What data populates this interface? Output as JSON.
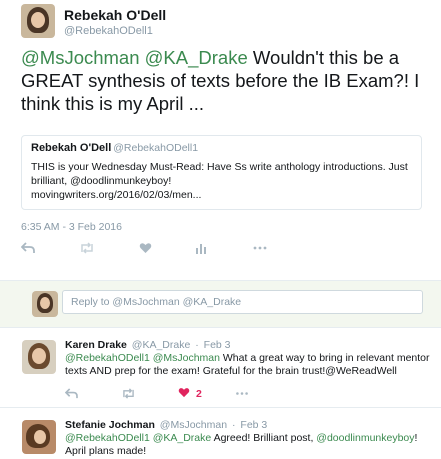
{
  "tweet": {
    "author_name": "Rebekah O'Dell",
    "author_handle": "@RebekahODell1",
    "text_mention1": "@MsJochman",
    "text_mention2": "@KA_Drake",
    "text_body": " Wouldn't this be a GREAT synthesis of texts before the IB Exam?! I think this is my April ...",
    "timestamp": "6:35 AM - 3 Feb 2016",
    "quote": {
      "name": "Rebekah O'Dell",
      "handle": "@RebekahODell1",
      "line1": "THIS is your Wednesday Must-Read: Have Ss write anthology introductions. Just",
      "line2": "brilliant, @doodlinmunkeyboy!",
      "line3": "movingwriters.org/2016/02/03/men..."
    },
    "actions": {
      "reply_icon": "reply-icon",
      "retweet_icon": "retweet-icon",
      "like_icon": "heart-icon",
      "stats_icon": "analytics-icon",
      "more_icon": "more-icon"
    }
  },
  "reply_box": {
    "placeholder": "Reply to @MsJochman @KA_Drake"
  },
  "replies": [
    {
      "name": "Karen Drake",
      "handle": "@KA_Drake",
      "date": "Feb 3",
      "mention1": "@RebekahODell1",
      "mention2": "@MsJochman",
      "text": " What a great way to bring in relevant mentor texts AND prep for the exam! Grateful for the brain trust!@WeReadWell",
      "like_count": "2"
    },
    {
      "name": "Stefanie Jochman",
      "handle": "@MsJochman",
      "date": "Feb 3",
      "mention1": "@RebekahODell1",
      "mention2": "@KA_Drake",
      "text_a": " Agreed! Brilliant post, ",
      "mention3": "@doodlinmunkeyboy",
      "text_b": "! April plans made!"
    }
  ],
  "colors": {
    "accent": "#3b8a4f",
    "muted": "#8899a6",
    "like": "#e0245e",
    "reply_bg": "#f3f7ef"
  }
}
